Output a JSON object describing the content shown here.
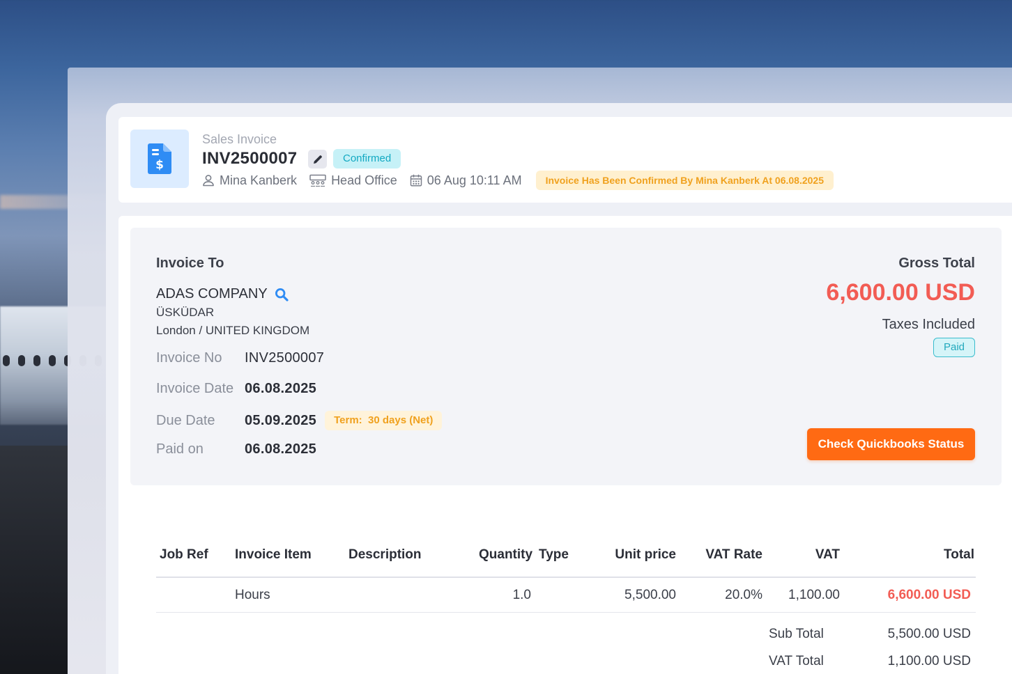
{
  "header": {
    "doc_type": "Sales Invoice",
    "doc_number": "INV2500007",
    "status": "Confirmed",
    "user": "Mina Kanberk",
    "branch": "Head Office",
    "datetime": "06 Aug 10:11 AM",
    "confirm_note": "Invoice Has Been Confirmed By Mina Kanberk At 06.08.2025"
  },
  "invoice_to": {
    "title": "Invoice To",
    "company": "ADAS COMPANY",
    "address_line1": "ÜSKÜDAR",
    "address_line2": "London / UNITED KINGDOM"
  },
  "details": {
    "invoice_no_label": "Invoice No",
    "invoice_no": "INV2500007",
    "invoice_date_label": "Invoice Date",
    "invoice_date": "06.08.2025",
    "due_date_label": "Due Date",
    "due_date": "05.09.2025",
    "term_label": "Term:",
    "term_value": "30 days (Net)",
    "paid_on_label": "Paid on",
    "paid_on": "06.08.2025"
  },
  "totals": {
    "gross_label": "Gross Total",
    "gross_value": "6,600.00 USD",
    "taxes_note": "Taxes Included",
    "payment_status": "Paid",
    "quickbooks_button": "Check Quickbooks Status"
  },
  "table": {
    "headers": {
      "job_ref": "Job Ref",
      "item": "Invoice Item",
      "description": "Description",
      "quantity": "Quantity",
      "type": "Type",
      "unit_price": "Unit price",
      "vat_rate": "VAT Rate",
      "vat": "VAT",
      "total": "Total"
    },
    "rows": [
      {
        "job_ref": "",
        "item": "Hours",
        "description": "",
        "quantity": "1.0",
        "type": "",
        "unit_price": "5,500.00",
        "vat_rate": "20.0%",
        "vat": "1,100.00",
        "total": "6,600.00 USD"
      }
    ]
  },
  "summary": {
    "sub_total_label": "Sub Total",
    "sub_total": "5,500.00 USD",
    "vat_total_label": "VAT Total",
    "vat_total": "1,100.00 USD"
  },
  "colors": {
    "accent_orange": "#ff6a13",
    "amount_red": "#f25c54",
    "status_cyan": "#12a9c2",
    "note_amber": "#f0a11e",
    "doc_blue": "#2f8cf4"
  },
  "icons": {
    "doc": "invoice-dollar-icon",
    "edit": "pencil-icon",
    "user": "user-icon",
    "branch": "building-icon",
    "date": "calendar-icon",
    "search": "search-icon"
  }
}
